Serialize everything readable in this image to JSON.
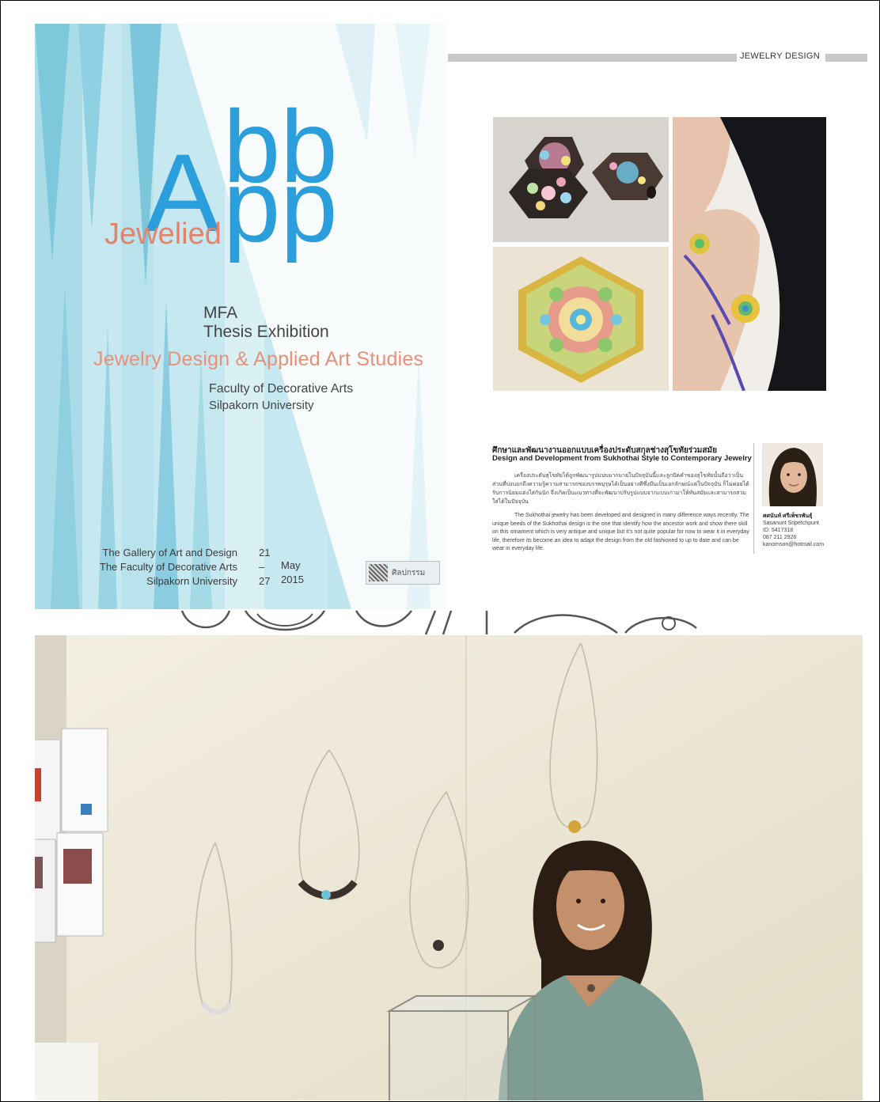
{
  "poster": {
    "big_letters_top": "bb",
    "big_letter_a": "A",
    "big_letters_bottom": "pp",
    "script_word": "Jewelied",
    "line_mfa": "MFA",
    "line_thesis": "Thesis Exhibition",
    "line_studies": "Jewelry Design & Applied Art Studies",
    "line_faculty": "Faculty of Decorative Arts",
    "line_university": "Silpakorn University",
    "venue": [
      "The Gallery of Art and Design",
      "The Faculty of Decorative Arts",
      "Silpakorn University"
    ],
    "dates": [
      "21",
      "–",
      "27"
    ],
    "month_year": [
      "May",
      "2015"
    ],
    "logo_text": "ศิลปกรรม"
  },
  "magazine": {
    "section_label": "JEWELRY DESIGN",
    "title_th": "ศึกษาและพัฒนางานออกแบบเครื่องประดับสกุลช่างสุโขทัยร่วมสมัย",
    "title_en": "Design and Development from Sukhothai Style to Contemporary Jewelry",
    "body_th": "เครื่องประดับสุโขทัยได้ถูกพัฒนารูปแบบมากมายในปัจจุบันนี้และลูกปัดคำของสุโขทัยนั้นถือว่าเป็นส่วนที่บ่งบอกถึงความรู้ความสามารถของบรรพบุรุษได้เป็นอย่างดีซึ่งมีนเป็นเอกลักษณ์แต่ในปัจจุบัน ก็ไม่ค่อยได้รับการนิยมแต่งใส่กันนัก จึงเกิดเป็นแนวทางที่จะพัฒนาปรับรูปแบบจากแบบเก่ามาให้ทันสมัยและสามารถสวมใส่ได้ในปัจจุบัน",
    "body_en": "The Sukhothai jewelry has been developed and designed in many difference ways recently. The unique beeds of the Sukhothai design is the one that identify how the ancestor work and show there skill on this ornament which is very antique and unique but it's not quite popular for now to wear it in everyday life, therefore its become an idea to adapt the design from the old fashioned to up to date and can be wear in everyday life.",
    "author_th": "ศศนันท์ ศรีเพ็ชรพันธุ์",
    "author_en": "Sasanunt Sripetchpunt",
    "author_id": "ID: 5417318",
    "author_phone": "087 211 2926",
    "author_email": "kanomson@hotmail.com"
  },
  "colors": {
    "poster_bg": "#c9eaf1",
    "poster_blue": "#2aa0dc",
    "poster_salmon": "#e3836c",
    "header_bar": "#c9c9c9"
  }
}
